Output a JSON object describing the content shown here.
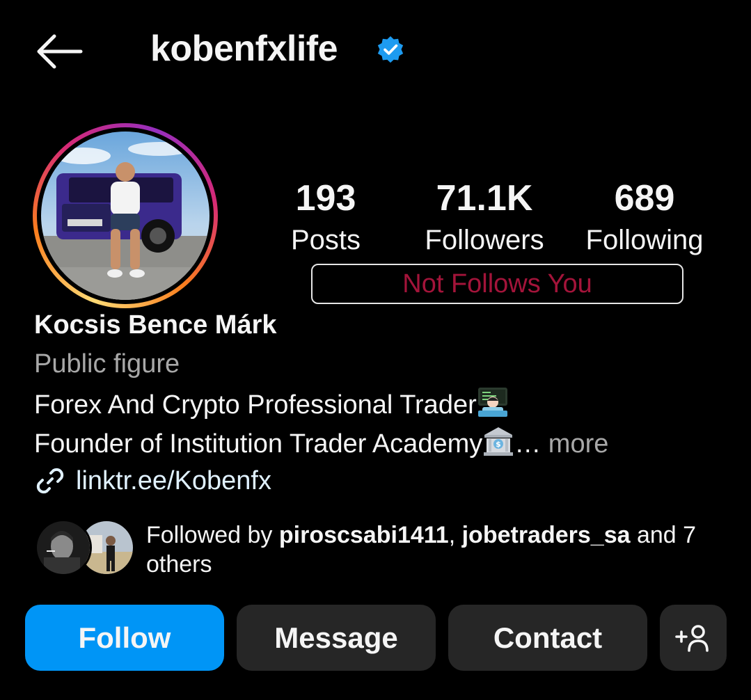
{
  "header": {
    "username": "kobenfxlife",
    "verified": true,
    "back_icon": "back-arrow-icon",
    "verified_icon": "verified-badge-icon",
    "verified_color": "#1d9bf0"
  },
  "stats": [
    {
      "value": "193",
      "label": "Posts"
    },
    {
      "value": "71.1K",
      "label": "Followers"
    },
    {
      "value": "689",
      "label": "Following"
    }
  ],
  "follow_status": {
    "text": "Not Follows You",
    "color": "#a3143a"
  },
  "profile": {
    "full_name": "Kocsis Bence Márk",
    "category": "Public figure",
    "bio_line_1": "Forex And Crypto Professional Trader",
    "bio_line_2": "Founder of Institution Trader Academy",
    "ellipsis": "…",
    "more_label": " more",
    "link_icon": "link-icon",
    "link": "linktr.ee/Kobenfx"
  },
  "followed_by": {
    "prefix": "Followed by ",
    "user_1": "piroscsabi1411",
    "separator": ", ",
    "user_2": "jobetraders_sa",
    "suffix": " and 7 others"
  },
  "actions": {
    "follow_label": "Follow",
    "message_label": "Message",
    "contact_label": "Contact",
    "suggest_icon": "add-person-icon",
    "follow_color": "#0095f6"
  }
}
